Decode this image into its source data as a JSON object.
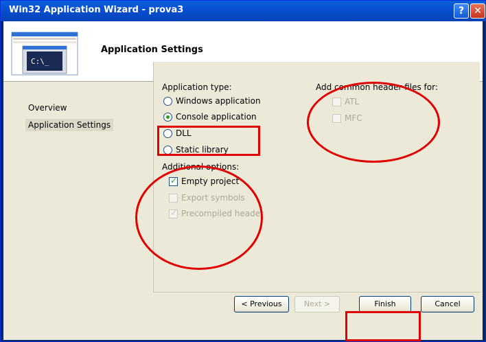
{
  "window": {
    "title": "Win32 Application Wizard - prova3",
    "help_glyph": "?",
    "close_glyph": "✕"
  },
  "header": {
    "title": "Application Settings",
    "icon": "console-window-icon",
    "icon_prompt": "C:\\_"
  },
  "nav": {
    "items": [
      {
        "label": "Overview",
        "selected": false
      },
      {
        "label": "Application Settings",
        "selected": true
      }
    ]
  },
  "app_type": {
    "label": "Application type:",
    "options": [
      {
        "label": "Windows application",
        "selected": false
      },
      {
        "label": "Console application",
        "selected": true
      },
      {
        "label": "DLL",
        "selected": false
      },
      {
        "label": "Static library",
        "selected": false
      }
    ]
  },
  "additional": {
    "label": "Additional options:",
    "options": [
      {
        "label": "Empty project",
        "checked": true,
        "enabled": true
      },
      {
        "label": "Export symbols",
        "checked": false,
        "enabled": false
      },
      {
        "label": "Precompiled header",
        "checked": true,
        "enabled": false
      }
    ]
  },
  "headers": {
    "label": "Add common header files for:",
    "options": [
      {
        "label": "ATL",
        "checked": false,
        "enabled": false
      },
      {
        "label": "MFC",
        "checked": false,
        "enabled": false
      }
    ]
  },
  "buttons": {
    "previous": "< Previous",
    "next": "Next >",
    "finish": "Finish",
    "cancel": "Cancel"
  },
  "colors": {
    "titlebar": "#0a5fdc",
    "annotation": "#e00000",
    "radio_dot": "#21a121"
  }
}
